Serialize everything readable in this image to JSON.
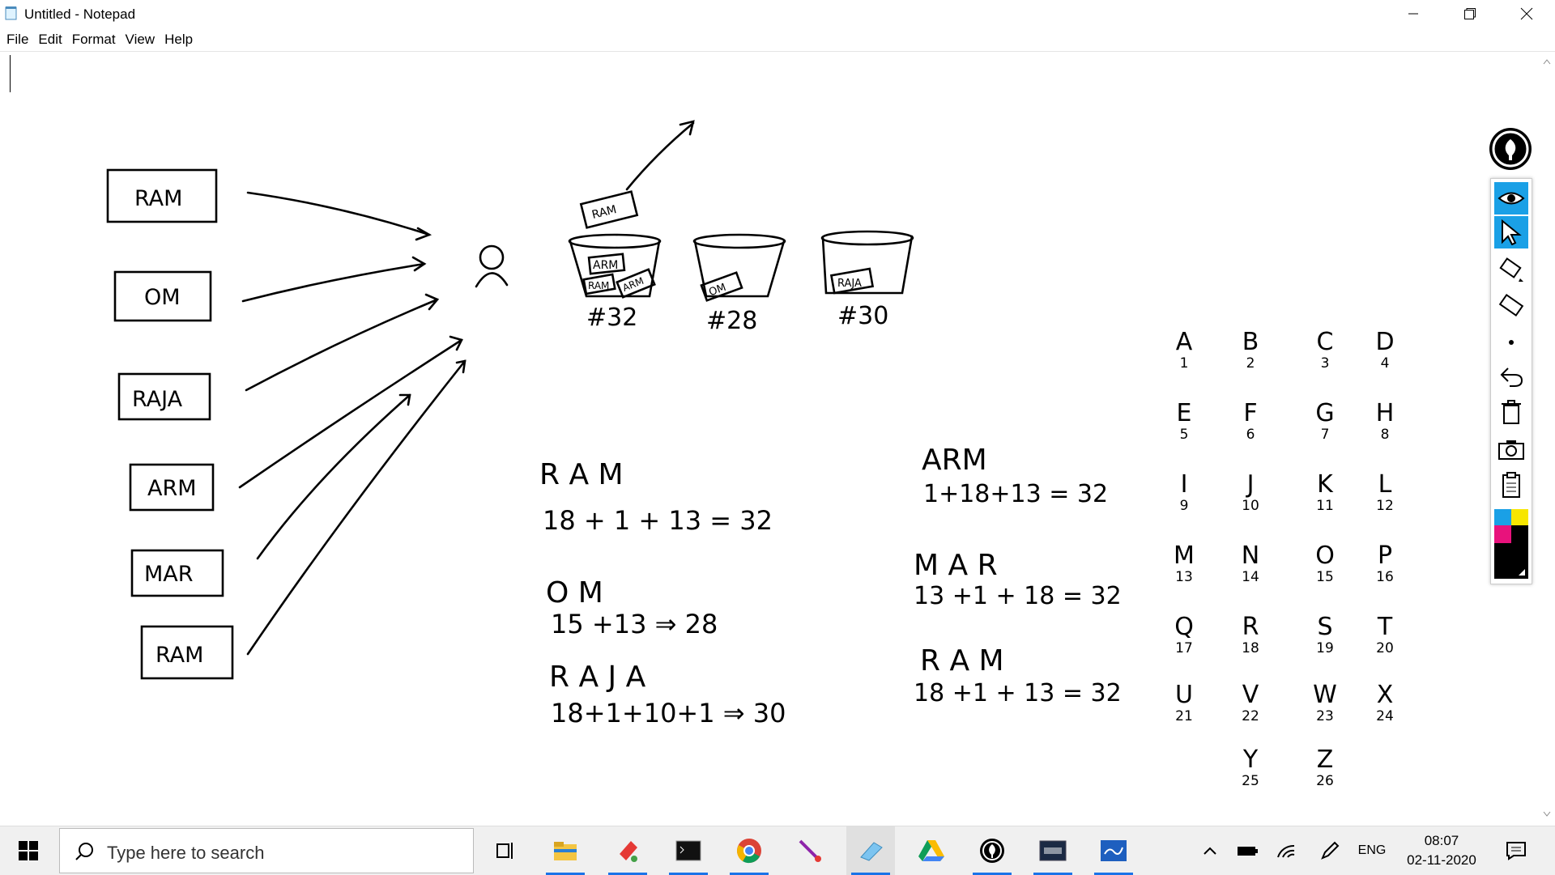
{
  "window": {
    "title": "Untitled - Notepad",
    "icons": [
      "notepad-icon",
      "minimize-icon",
      "maximize-icon",
      "close-icon"
    ]
  },
  "menu": {
    "items": [
      "File",
      "Edit",
      "Format",
      "View",
      "Help"
    ]
  },
  "sketch": {
    "inputs": [
      "RAM",
      "OM",
      "RAJA",
      "ARM",
      "MAR",
      "RAM"
    ],
    "box_labels": [
      "RAM",
      "RAM",
      "OM",
      "RAM",
      "ARM",
      "OM",
      "RAJA"
    ],
    "buckets": [
      "#32",
      "#28",
      "#30"
    ],
    "left_calc": [
      {
        "word": "R   A   M",
        "expr": "18 + 1 + 13   =   32"
      },
      {
        "word": "O  M",
        "expr": "15 +13  ⇒  28"
      },
      {
        "word": "R A J A",
        "expr": "18+1+10+1  ⇒  30"
      }
    ],
    "right_calc": [
      {
        "word": "ARM",
        "expr": "1+18+13  =   32"
      },
      {
        "word": "M  A  R",
        "expr": "13 +1 + 18 =   32"
      },
      {
        "word": "R   A   M",
        "expr": "18 +1  + 13   = 32"
      }
    ],
    "alphabet": [
      [
        "A",
        "1"
      ],
      [
        "B",
        "2"
      ],
      [
        "C",
        "3"
      ],
      [
        "D",
        "4"
      ],
      [
        "E",
        "5"
      ],
      [
        "F",
        "6"
      ],
      [
        "G",
        "7"
      ],
      [
        "H",
        "8"
      ],
      [
        "I",
        "9"
      ],
      [
        "J",
        "10"
      ],
      [
        "K",
        "11"
      ],
      [
        "L",
        "12"
      ],
      [
        "M",
        "13"
      ],
      [
        "N",
        "14"
      ],
      [
        "O",
        "15"
      ],
      [
        "P",
        "16"
      ],
      [
        "Q",
        "17"
      ],
      [
        "R",
        "18"
      ],
      [
        "S",
        "19"
      ],
      [
        "T",
        "20"
      ],
      [
        "U",
        "21"
      ],
      [
        "V",
        "22"
      ],
      [
        "W",
        "23"
      ],
      [
        "X",
        "24"
      ],
      [
        "Y",
        "25"
      ],
      [
        "Z",
        "26"
      ]
    ]
  },
  "pen_toolbar": {
    "icons": [
      "epic-pen-logo-icon",
      "eye-icon",
      "cursor-icon",
      "highlighter-icon",
      "eraser-icon",
      "dot-icon",
      "undo-icon",
      "trash-icon",
      "camera-icon",
      "clipboard-icon",
      "color-palette-icon"
    ],
    "colors": [
      "#1aa0e6",
      "#f7e600",
      "#e8127c",
      "#000000"
    ]
  },
  "taskbar": {
    "search_placeholder": "Type here to search",
    "apps": [
      "task-view-icon",
      "file-explorer-icon",
      "paint-icon",
      "terminal-icon",
      "chrome-icon",
      "sniping-tool-icon",
      "notepad-icon",
      "google-drive-icon",
      "epic-pen-icon",
      "mysql-icon",
      "whiteboard-icon"
    ],
    "tray_icons": [
      "chevron-up-icon",
      "battery-icon",
      "wifi-icon",
      "pen-icon"
    ],
    "language": "ENG",
    "time": "08:07",
    "date": "02-11-2020"
  }
}
